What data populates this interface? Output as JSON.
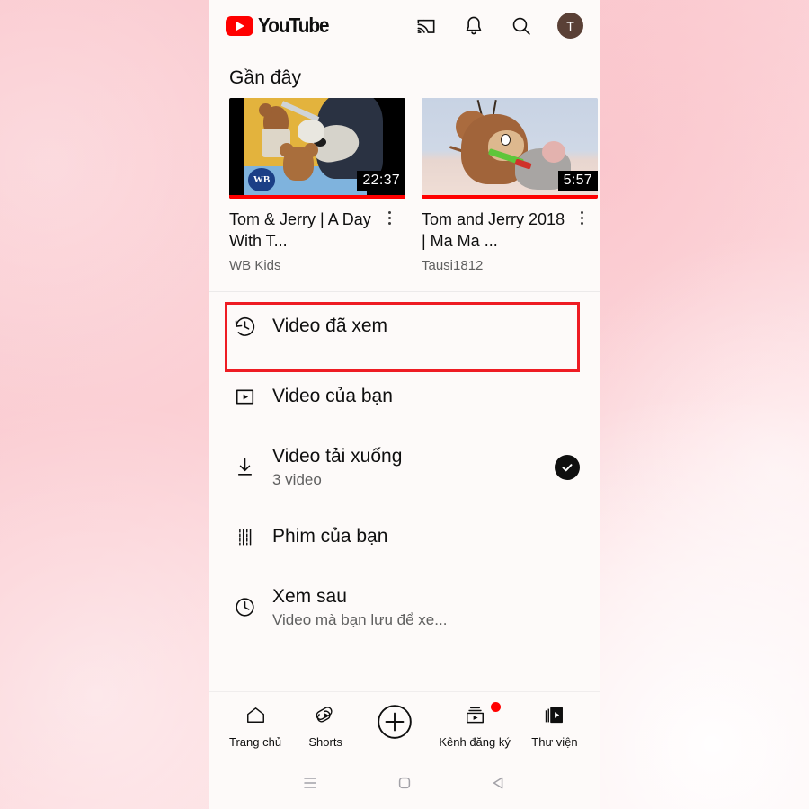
{
  "app": {
    "name": "YouTube",
    "logo_icon": "youtube-play-logo"
  },
  "appbar": {
    "cast_icon": "cast-icon",
    "notifications_icon": "bell-icon",
    "search_icon": "search-icon",
    "avatar_initial": "T"
  },
  "recent": {
    "heading": "Gần đây",
    "videos": [
      {
        "title": "Tom & Jerry | A Day With T...",
        "channel": "WB Kids",
        "duration": "22:37",
        "watermark": "WB",
        "menu_icon": "kebab-menu-icon"
      },
      {
        "title": "Tom and Jerry 2018 | Ma Ma ...",
        "channel": "Tausi1812",
        "duration": "5:57",
        "menu_icon": "kebab-menu-icon"
      }
    ]
  },
  "menu": {
    "items": [
      {
        "label": "Video đã xem",
        "sub": "",
        "icon": "history-clock-icon",
        "highlighted": true,
        "trailing": ""
      },
      {
        "label": "Video của bạn",
        "sub": "",
        "icon": "video-play-box-icon",
        "highlighted": false,
        "trailing": ""
      },
      {
        "label": "Video tải xuống",
        "sub": "3 video",
        "icon": "download-arrow-icon",
        "highlighted": false,
        "trailing": "check-badge-icon"
      },
      {
        "label": "Phim của bạn",
        "sub": "",
        "icon": "film-strip-icon",
        "highlighted": false,
        "trailing": ""
      },
      {
        "label": "Xem sau",
        "sub": "Video mà bạn lưu để xe...",
        "icon": "clock-icon",
        "highlighted": false,
        "trailing": ""
      }
    ]
  },
  "bottom_nav": {
    "items": [
      {
        "label": "Trang chủ",
        "icon": "home-icon",
        "badge": false
      },
      {
        "label": "Shorts",
        "icon": "shorts-icon",
        "badge": false
      },
      {
        "label": "",
        "icon": "create-plus-icon",
        "badge": false
      },
      {
        "label": "Kênh đăng ký",
        "icon": "subscriptions-icon",
        "badge": true
      },
      {
        "label": "Thư viện",
        "icon": "library-icon",
        "badge": false
      }
    ]
  },
  "system_nav": {
    "items": [
      {
        "icon": "recent-apps-icon"
      },
      {
        "icon": "home-square-icon"
      },
      {
        "icon": "back-triangle-icon"
      }
    ]
  },
  "colors": {
    "brand_red": "#ff0000",
    "highlight_red": "#ee1c23",
    "text_primary": "#0f0f0f",
    "text_secondary": "#606060",
    "screen_bg": "#fdfaf9",
    "backdrop_pink": "#fac8ce",
    "avatar_bg": "#5a4036"
  }
}
